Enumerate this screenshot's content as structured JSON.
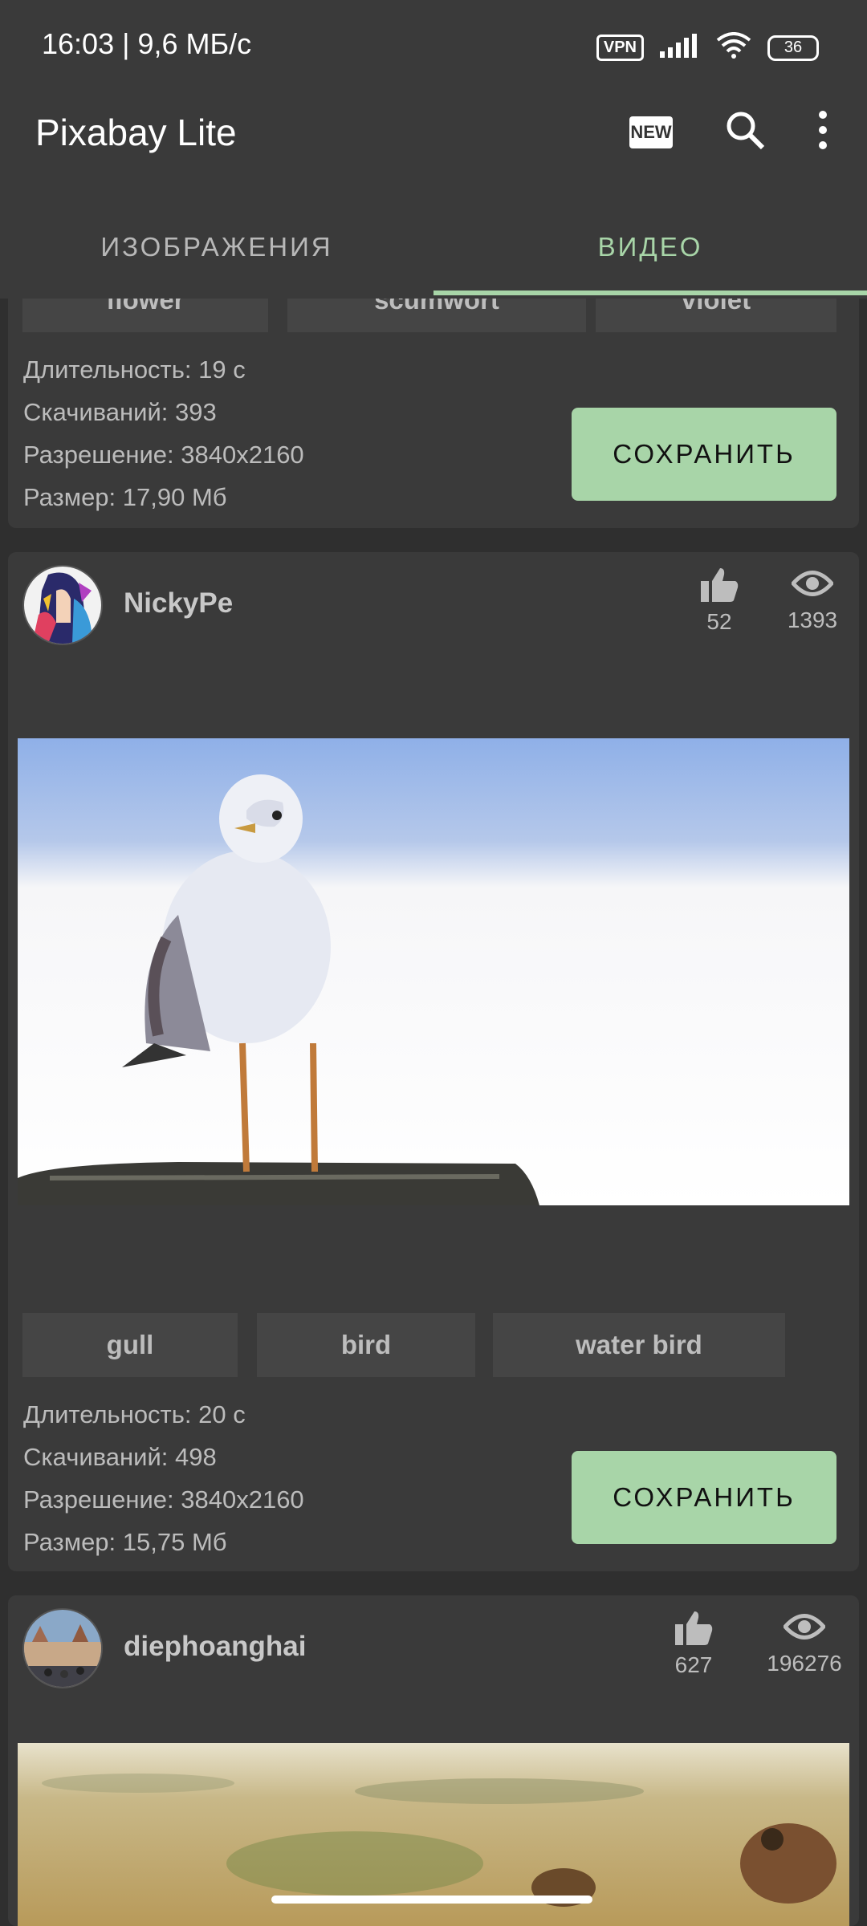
{
  "status": {
    "time": "16:03 | 9,6 МБ/с",
    "vpn": "VPN",
    "battery": "36"
  },
  "app": {
    "title": "Pixabay Lite",
    "new_badge": "NEW"
  },
  "tabs": [
    {
      "label": "ИЗОБРАЖЕНИЯ"
    },
    {
      "label": "ВИДЕО"
    }
  ],
  "cards": [
    {
      "tags": [
        "flower",
        "scumwort",
        "violet"
      ],
      "info": [
        "Длительность: 19 с",
        "Скачиваний: 393",
        "Разрешение: 3840x2160",
        "Размер: 17,90 Мб"
      ],
      "save_label": "СОХРАНИТЬ"
    },
    {
      "user": "NickyPe",
      "likes": "52",
      "views": "1393",
      "tags": [
        "gull",
        "bird",
        "water bird"
      ],
      "info": [
        "Длительность: 20 с",
        "Скачиваний: 498",
        "Разрешение: 3840x2160",
        "Размер: 15,75 Мб"
      ],
      "save_label": "СОХРАНИТЬ"
    },
    {
      "user": "diephoanghai",
      "likes": "627",
      "views": "196276"
    }
  ]
}
